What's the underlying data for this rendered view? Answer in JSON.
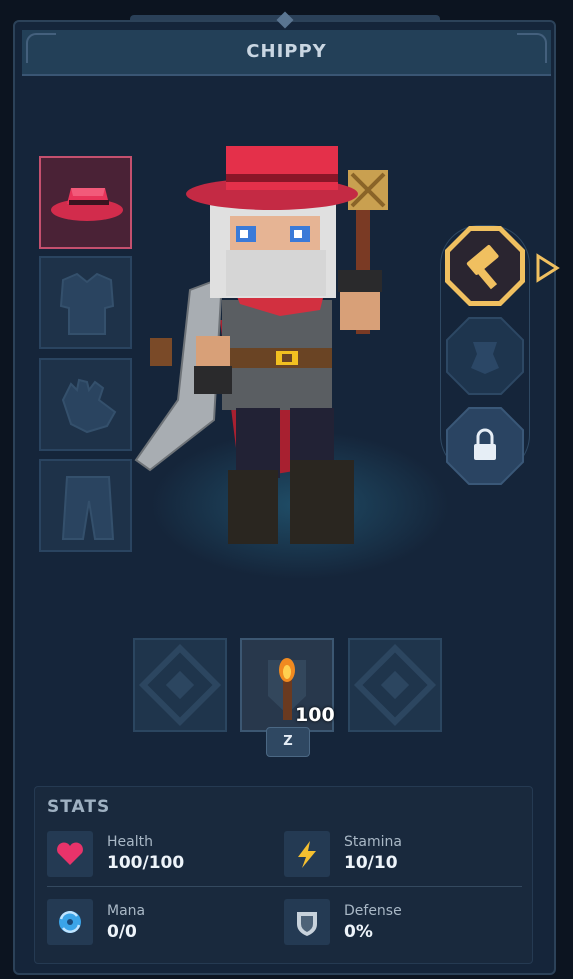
{
  "header": {
    "title": "CHIPPY"
  },
  "equipment": {
    "slots": [
      {
        "name": "hat",
        "icon": "red-hat-icon",
        "selected": true
      },
      {
        "name": "chest",
        "icon": "chest-armor-icon",
        "selected": false
      },
      {
        "name": "gloves",
        "icon": "glove-icon",
        "selected": false
      },
      {
        "name": "pants",
        "icon": "pants-icon",
        "selected": false
      }
    ]
  },
  "weapon_slots": [
    {
      "icon": "hammer-icon",
      "active": true
    },
    {
      "icon": "armor-rune-icon",
      "active": false
    },
    {
      "icon": "lock-icon",
      "active": false
    }
  ],
  "toolbar": {
    "item_count": "100",
    "hotkey": "Z",
    "center_icon": "torch-icon"
  },
  "stats": {
    "title": "STATS",
    "items": [
      {
        "label": "Health",
        "value": "100/100",
        "icon": "heart-icon",
        "color": "#e8336a"
      },
      {
        "label": "Stamina",
        "value": "10/10",
        "icon": "lightning-icon",
        "color": "#f5c030"
      },
      {
        "label": "Mana",
        "value": "0/0",
        "icon": "mana-swirl-icon",
        "color": "#3aa4e8"
      },
      {
        "label": "Defense",
        "value": "0%",
        "icon": "shield-icon",
        "color": "#c8d2dc"
      }
    ]
  },
  "colors": {
    "panel": "#15253a",
    "accent_gold": "#f0c060",
    "selected_slot": "#c4506e"
  }
}
